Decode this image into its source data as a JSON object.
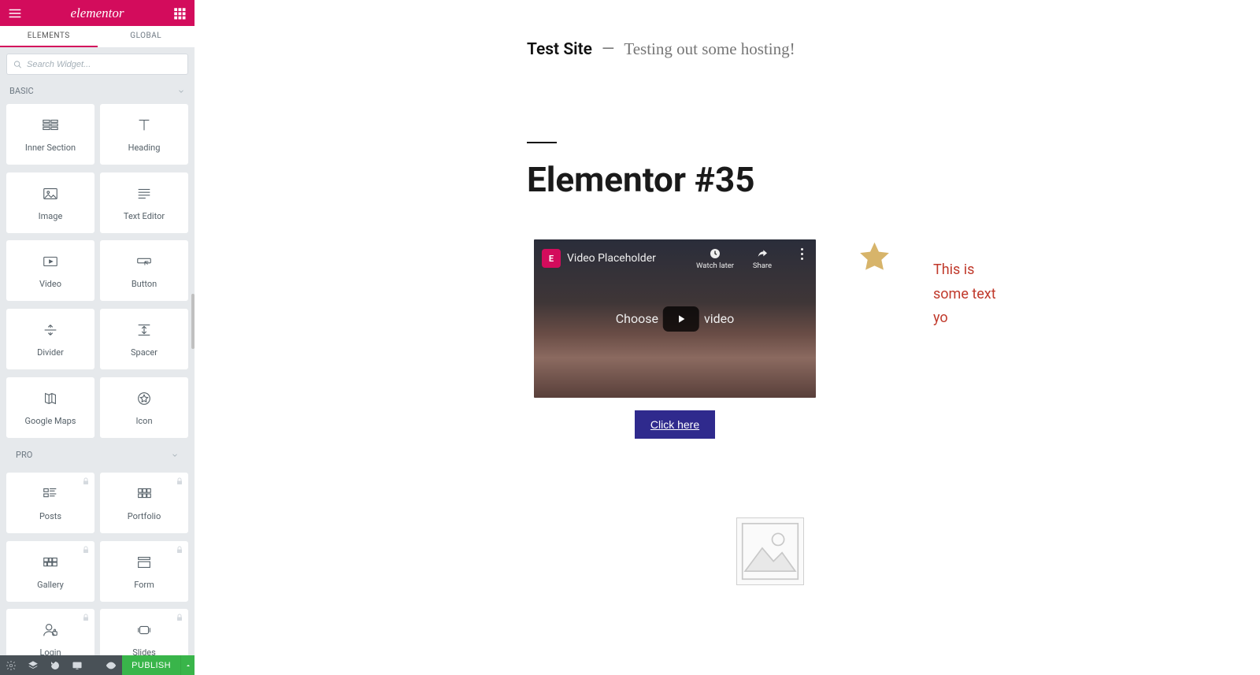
{
  "brand": {
    "logo": "elementor"
  },
  "tabs": {
    "elements": "ELEMENTS",
    "global": "GLOBAL"
  },
  "search": {
    "placeholder": "Search Widget..."
  },
  "categories": {
    "basic": {
      "label": "BASIC",
      "widgets": [
        {
          "name": "inner-section",
          "label": "Inner Section"
        },
        {
          "name": "heading",
          "label": "Heading"
        },
        {
          "name": "image",
          "label": "Image"
        },
        {
          "name": "text-editor",
          "label": "Text Editor"
        },
        {
          "name": "video",
          "label": "Video"
        },
        {
          "name": "button",
          "label": "Button"
        },
        {
          "name": "divider",
          "label": "Divider"
        },
        {
          "name": "spacer",
          "label": "Spacer"
        },
        {
          "name": "google-maps",
          "label": "Google Maps"
        },
        {
          "name": "icon",
          "label": "Icon"
        }
      ]
    },
    "pro": {
      "label": "PRO",
      "widgets": [
        {
          "name": "posts",
          "label": "Posts",
          "locked": true
        },
        {
          "name": "portfolio",
          "label": "Portfolio",
          "locked": true
        },
        {
          "name": "gallery",
          "label": "Gallery",
          "locked": true
        },
        {
          "name": "form",
          "label": "Form",
          "locked": true
        },
        {
          "name": "login",
          "label": "Login",
          "locked": true
        },
        {
          "name": "slides",
          "label": "Slides",
          "locked": true
        }
      ]
    }
  },
  "footer": {
    "publish": "PUBLISH"
  },
  "page": {
    "site_title": "Test Site",
    "site_sep": "—",
    "site_tagline": "Testing out some hosting!",
    "title": "Elementor #35",
    "video": {
      "title": "Video Placeholder",
      "watch_later": "Watch later",
      "share": "Share",
      "center_before": "Choose",
      "center_after": "video"
    },
    "button_label": "Click here",
    "text_block": "This is some text yo"
  }
}
